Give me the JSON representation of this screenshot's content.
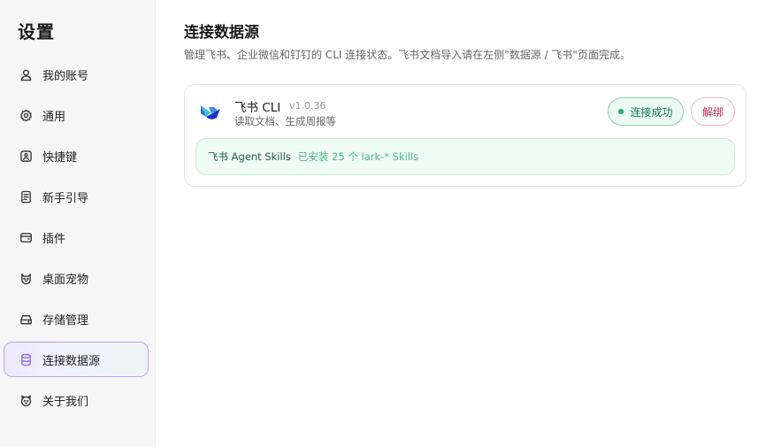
{
  "sidebar": {
    "title": "设置",
    "items": [
      {
        "label": "我的账号",
        "icon": "user-icon",
        "active": false
      },
      {
        "label": "通用",
        "icon": "gear-icon",
        "active": false
      },
      {
        "label": "快捷键",
        "icon": "keyboard-icon",
        "active": false
      },
      {
        "label": "新手引导",
        "icon": "document-icon",
        "active": false
      },
      {
        "label": "插件",
        "icon": "wallet-icon",
        "active": false
      },
      {
        "label": "桌面宠物",
        "icon": "pet-icon",
        "active": false
      },
      {
        "label": "存储管理",
        "icon": "storage-icon",
        "active": false
      },
      {
        "label": "连接数据源",
        "icon": "database-icon",
        "active": true
      },
      {
        "label": "关于我们",
        "icon": "pet-face-icon",
        "active": false
      }
    ]
  },
  "main": {
    "title": "连接数据源",
    "description": "管理飞书、企业微信和钉钉的 CLI 连接状态。飞书文档导入请在左侧\"数据源 / 飞书\"页面完成。",
    "card": {
      "logo": "feishu-logo-icon",
      "name": "飞书 CLI",
      "version": "v1.0.36",
      "description": "读取文档、生成周报等",
      "status": "连接成功",
      "status_color": "#22b07d",
      "unbind": "解绑",
      "skills": {
        "title": "飞书 Agent Skills",
        "status": "已安装 25 个 lark-* Skills"
      }
    }
  }
}
